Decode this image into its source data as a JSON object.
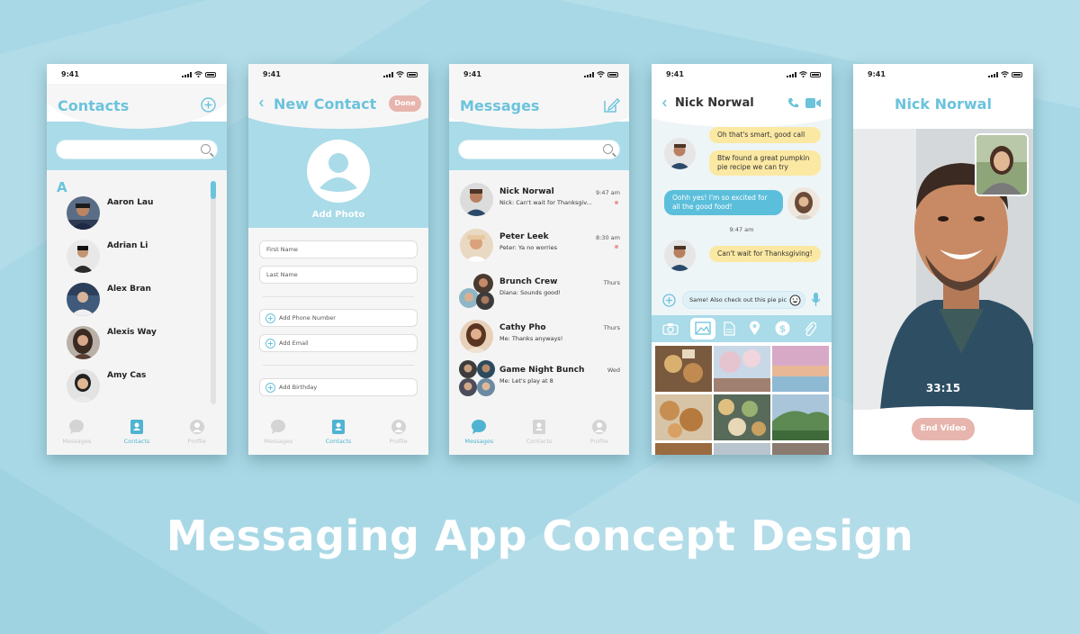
{
  "status_time": "9:41",
  "banner_title": "Messaging App Concept Design",
  "colors": {
    "accent": "#6bc3dc",
    "background": "#a8d8e5",
    "pink": "#e7b5ad",
    "yellow": "#fbe8a3",
    "blue_bubble": "#5bbfdb"
  },
  "tabs": {
    "messages": "Messages",
    "contacts": "Contacts",
    "profile": "Profile"
  },
  "contacts_screen": {
    "title": "Contacts",
    "add_icon": "plus-circle-icon",
    "search_icon": "search-icon",
    "section_letter": "A",
    "contacts": [
      "Aaron Lau",
      "Adrian Li",
      "Alex Bran",
      "Alexis Way",
      "Amy Cas"
    ]
  },
  "new_contact_screen": {
    "title": "New Contact",
    "done_label": "Done",
    "add_photo_label": "Add Photo",
    "first_name_placeholder": "First Name",
    "last_name_placeholder": "Last Name",
    "add_phone_label": "Add Phone Number",
    "add_email_label": "Add Email",
    "add_birthday_label": "Add Birthday"
  },
  "messages_screen": {
    "title": "Messages",
    "compose_icon": "compose-icon",
    "conversations": [
      {
        "name": "Nick Norwal",
        "preview": "Nick: Can't wait for Thanksgiv...",
        "time": "9:47 am",
        "unread": true
      },
      {
        "name": "Peter Leek",
        "preview": "Peter: Ya no worries",
        "time": "8:30 am",
        "unread": true
      },
      {
        "name": "Brunch Crew",
        "preview": "Diana: Sounds good!",
        "time": "Thurs",
        "unread": false
      },
      {
        "name": "Cathy Pho",
        "preview": "Me: Thanks anyways!",
        "time": "Thurs",
        "unread": false
      },
      {
        "name": "Game Night Bunch",
        "preview": "Me: Let's play at 8",
        "time": "Wed",
        "unread": false
      }
    ]
  },
  "chat_screen": {
    "contact_name": "Nick Norwal",
    "messages": [
      {
        "from": "them",
        "text": "Oh that's smart, good call"
      },
      {
        "from": "them",
        "text": "Btw found a great pumpkin pie recipe we can try"
      },
      {
        "from": "me",
        "text": "Oohh yes! I'm so excited for all the good food!"
      },
      {
        "from": "them",
        "text": "Can't wait for Thanksgiving!"
      }
    ],
    "timestamp": "9:47 am",
    "input_value": "Same! Also check out this pie pic",
    "attachment_icons": [
      "camera-icon",
      "image-icon",
      "file-icon",
      "location-icon",
      "dollar-icon",
      "paperclip-icon"
    ]
  },
  "video_screen": {
    "title": "Nick Norwal",
    "duration": "33:15",
    "end_label": "End Video"
  }
}
